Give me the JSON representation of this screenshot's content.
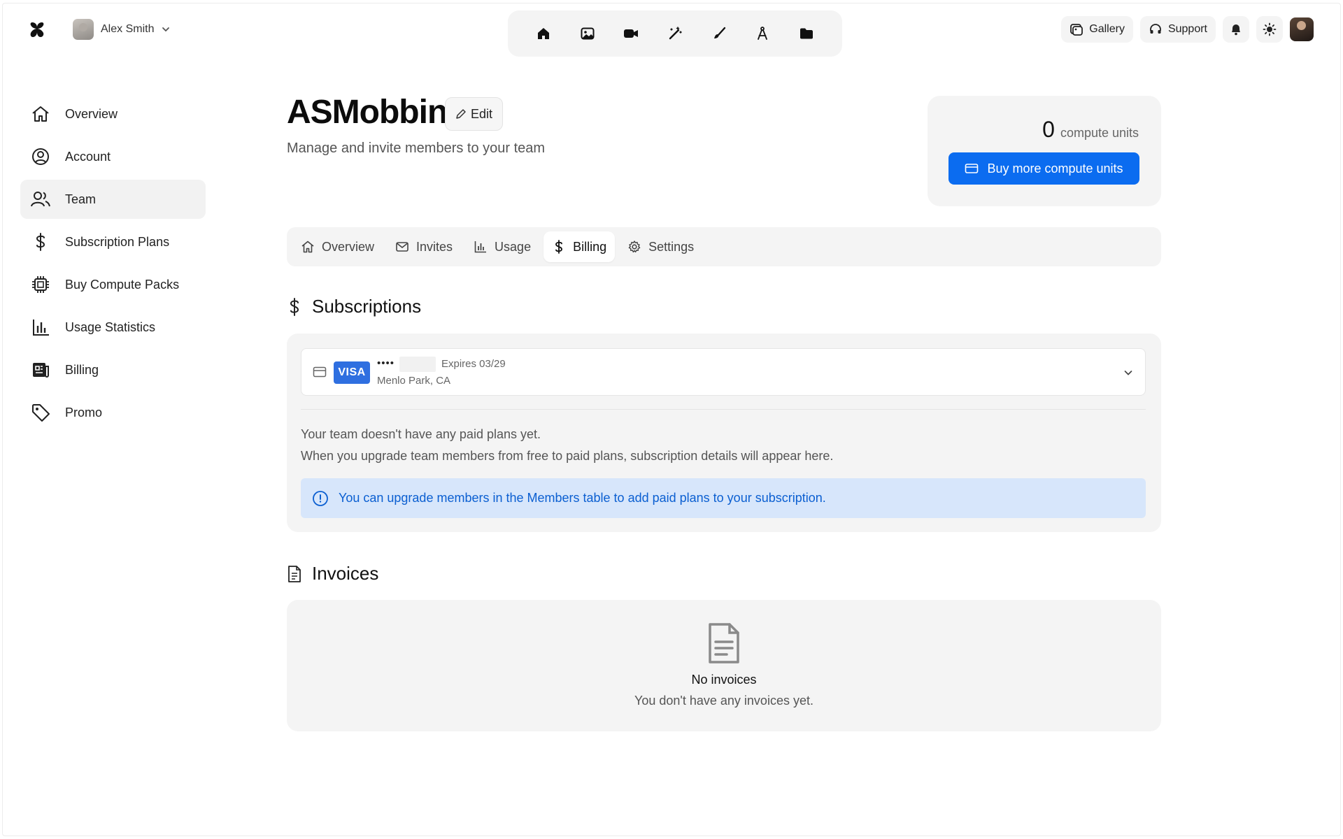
{
  "header": {
    "user_name": "Alex Smith",
    "gallery_label": "Gallery",
    "support_label": "Support",
    "tools": [
      "home-icon",
      "image-icon",
      "video-icon",
      "magic-wand-icon",
      "brush-icon",
      "compass-icon",
      "folder-icon"
    ]
  },
  "sidebar": {
    "items": [
      {
        "label": "Overview",
        "icon": "home-icon"
      },
      {
        "label": "Account",
        "icon": "user-circle-icon"
      },
      {
        "label": "Team",
        "icon": "team-icon",
        "active": true
      },
      {
        "label": "Subscription Plans",
        "icon": "dollar-icon"
      },
      {
        "label": "Buy Compute Packs",
        "icon": "chip-icon"
      },
      {
        "label": "Usage Statistics",
        "icon": "bar-chart-icon"
      },
      {
        "label": "Billing",
        "icon": "receipt-icon"
      },
      {
        "label": "Promo",
        "icon": "tag-icon"
      }
    ]
  },
  "page": {
    "title": "ASMobbin",
    "edit_label": "Edit",
    "subtitle": "Manage and invite members to your team"
  },
  "compute": {
    "count": "0",
    "unit_label": "compute units",
    "buy_label": "Buy more compute units"
  },
  "tabs": [
    {
      "label": "Overview",
      "icon": "home-icon"
    },
    {
      "label": "Invites",
      "icon": "mail-icon"
    },
    {
      "label": "Usage",
      "icon": "bar-chart-icon"
    },
    {
      "label": "Billing",
      "icon": "dollar-icon",
      "active": true
    },
    {
      "label": "Settings",
      "icon": "gear-icon"
    }
  ],
  "subscriptions": {
    "heading": "Subscriptions",
    "card": {
      "brand": "VISA",
      "masked": "••••",
      "expires": "Expires 03/29",
      "location": "Menlo Park, CA"
    },
    "empty_line1": "Your team doesn't have any paid plans yet.",
    "empty_line2": "When you upgrade team members from free to paid plans, subscription details will appear here.",
    "info": "You can upgrade members in the Members table to add paid plans to your subscription."
  },
  "invoices": {
    "heading": "Invoices",
    "empty_title": "No invoices",
    "empty_sub": "You don't have any invoices yet."
  },
  "colors": {
    "accent": "#0b6cf0",
    "info_bg": "#d7e6fb",
    "info_text": "#0b5fd1",
    "panel_bg": "#f4f4f4"
  }
}
